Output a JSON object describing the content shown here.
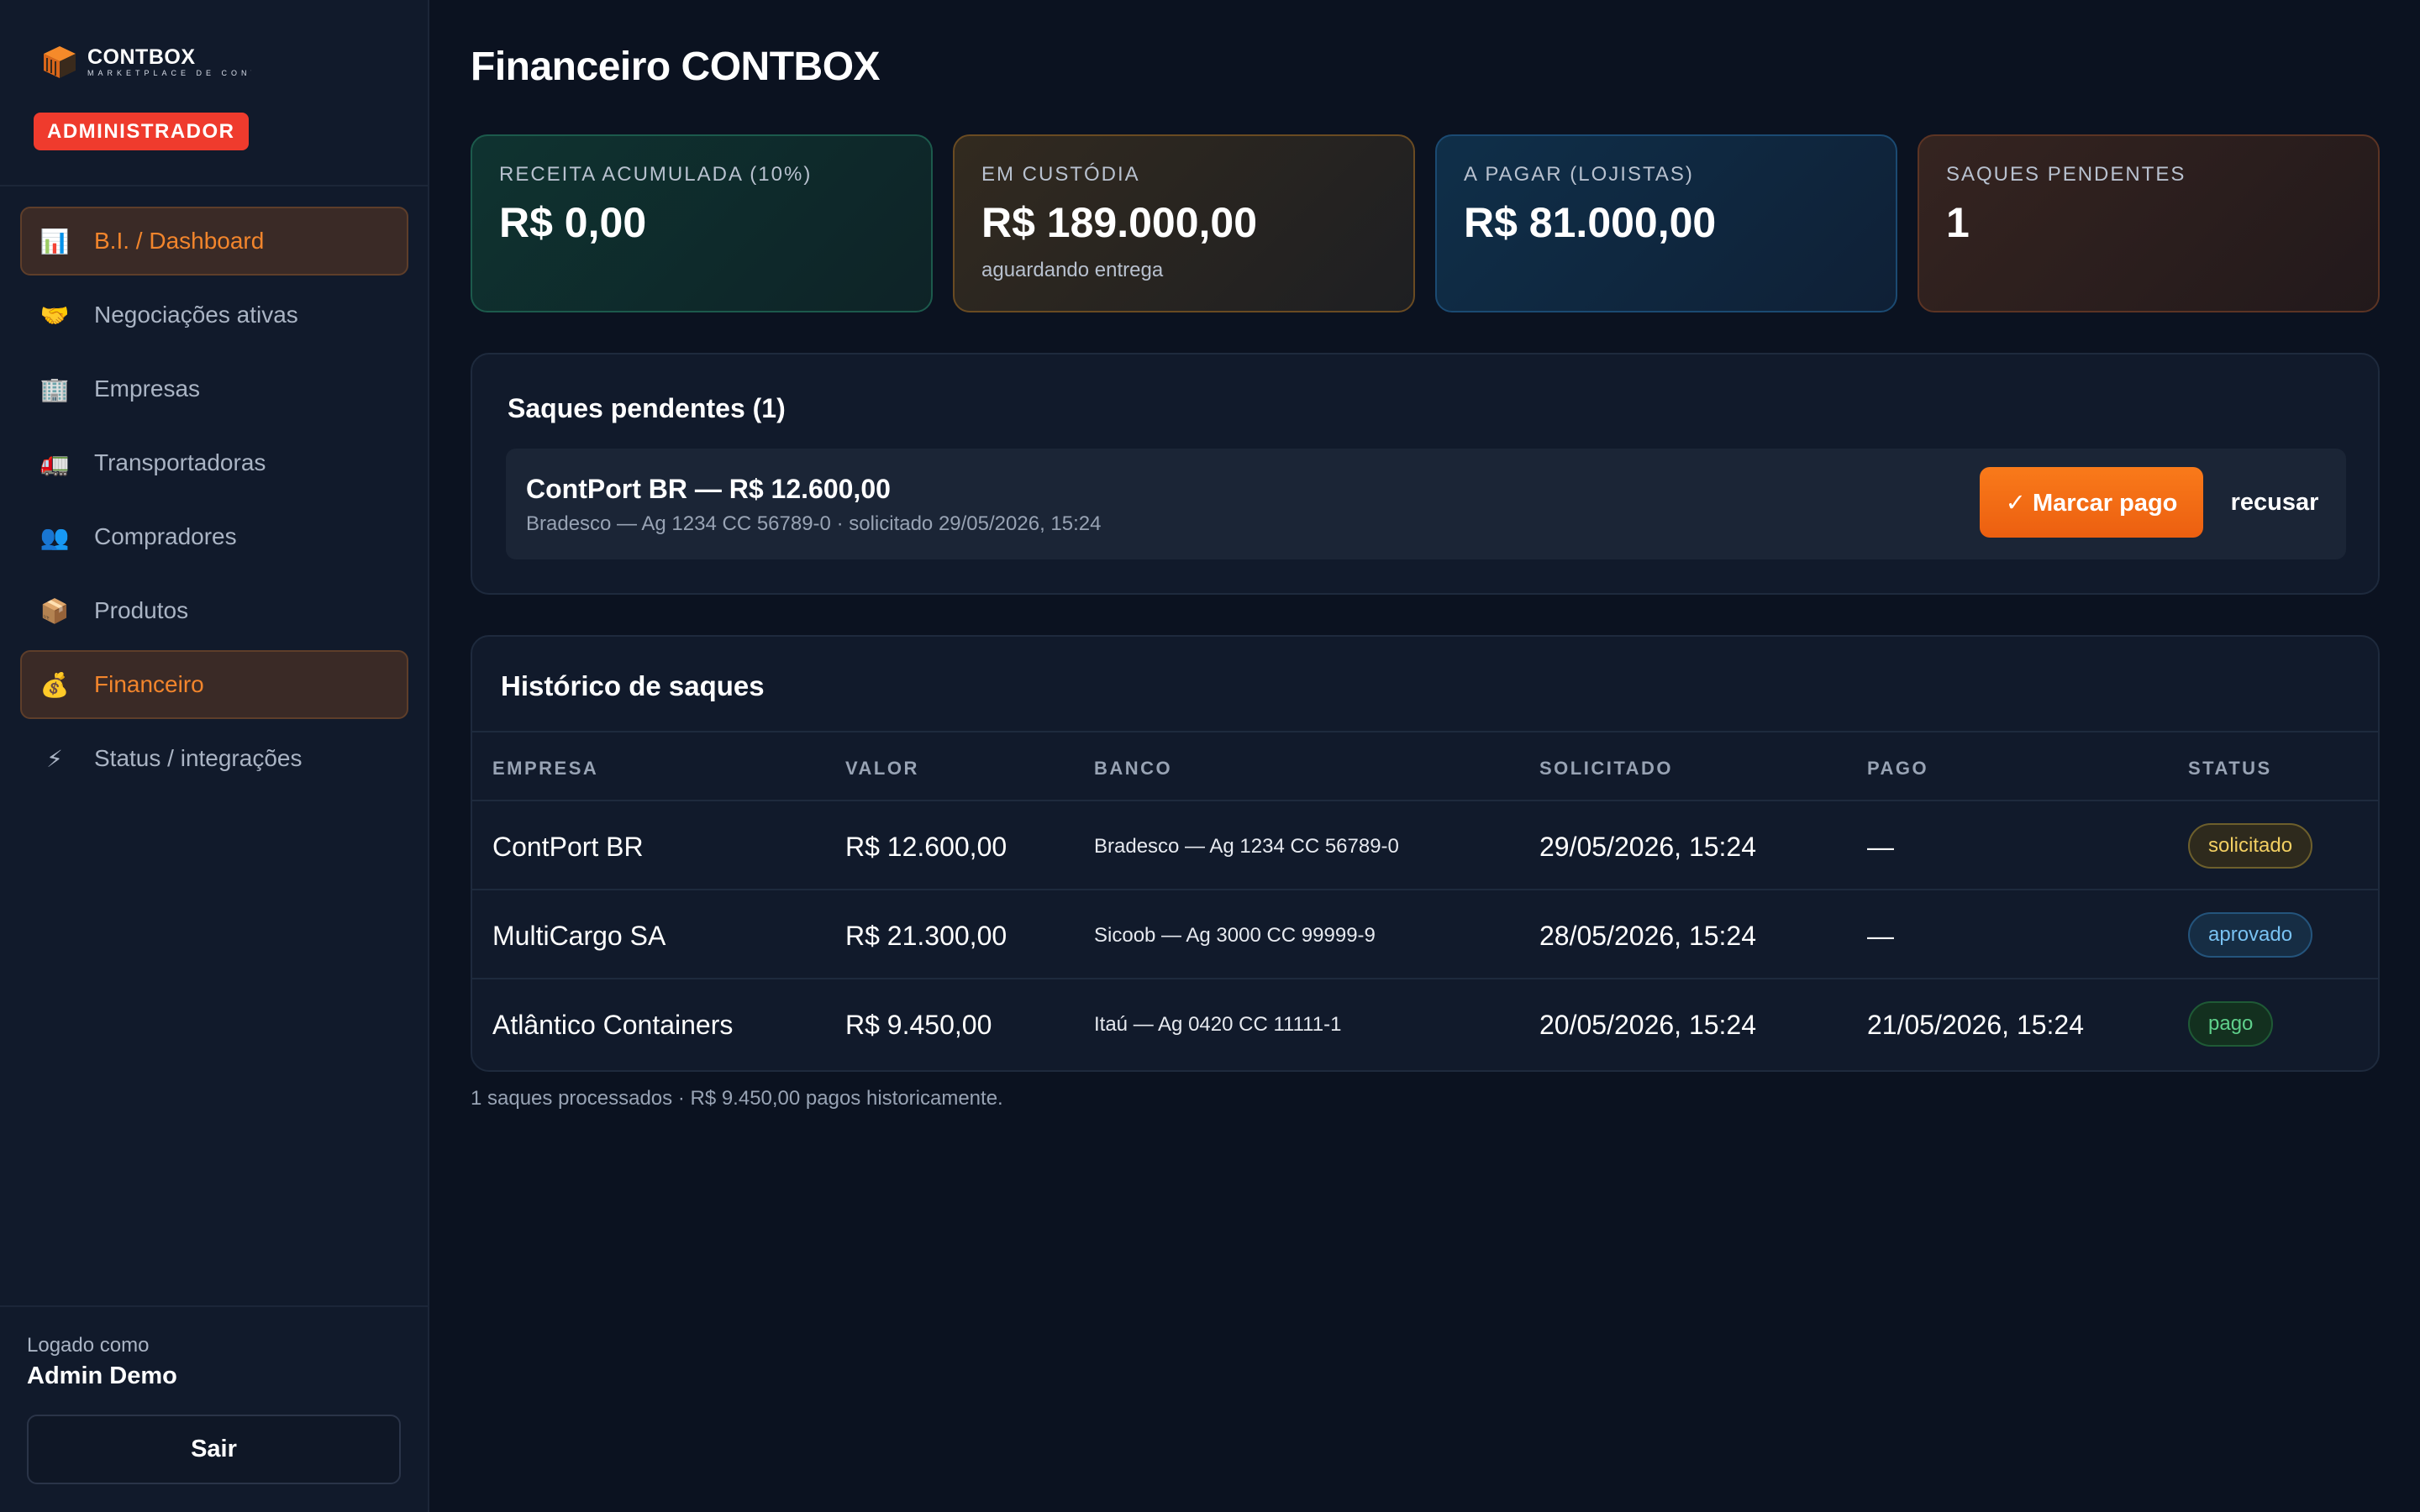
{
  "sidebar": {
    "brand": {
      "name": "CONTBOX",
      "tagline": "MARKETPLACE DE CONTAINERS"
    },
    "role_badge": "ADMINISTRADOR",
    "items": [
      {
        "label": "B.I. / Dashboard",
        "icon": "bar-chart-icon",
        "glyph": "📊",
        "active": true
      },
      {
        "label": "Negociações ativas",
        "icon": "handshake-icon",
        "glyph": "🤝",
        "active": false
      },
      {
        "label": "Empresas",
        "icon": "office-building-icon",
        "glyph": "🏢",
        "active": false
      },
      {
        "label": "Transportadoras",
        "icon": "truck-icon",
        "glyph": "🚛",
        "active": false
      },
      {
        "label": "Compradores",
        "icon": "users-icon",
        "glyph": "👥",
        "active": false
      },
      {
        "label": "Produtos",
        "icon": "package-icon",
        "glyph": "📦",
        "active": false
      },
      {
        "label": "Financeiro",
        "icon": "money-bag-icon",
        "glyph": "💰",
        "active": true
      },
      {
        "label": "Status / integrações",
        "icon": "lightning-icon",
        "glyph": "⚡",
        "active": false
      }
    ],
    "user": {
      "label": "Logado como",
      "name": "Admin Demo"
    },
    "logout_label": "Sair"
  },
  "main": {
    "title": "Financeiro CONTBOX",
    "kpis": [
      {
        "label": "RECEITA ACUMULADA (10%)",
        "value": "R$ 0,00",
        "sub": ""
      },
      {
        "label": "EM CUSTÓDIA",
        "value": "R$ 189.000,00",
        "sub": "aguardando entrega"
      },
      {
        "label": "A PAGAR (LOJISTAS)",
        "value": "R$ 81.000,00",
        "sub": ""
      },
      {
        "label": "SAQUES PENDENTES",
        "value": "1",
        "sub": ""
      }
    ],
    "pending": {
      "title": "Saques pendentes (1)",
      "item": {
        "main": "ContPort BR — R$ 12.600,00",
        "sub": "Bradesco — Ag 1234 CC 56789-0 · solicitado 29/05/2026, 15:24"
      },
      "pay_label": "✓ Marcar pago",
      "refuse_label": "recusar"
    },
    "history": {
      "title": "Histórico de saques",
      "columns": [
        "EMPRESA",
        "VALOR",
        "BANCO",
        "SOLICITADO",
        "PAGO",
        "STATUS"
      ],
      "rows": [
        {
          "empresa": "ContPort BR",
          "valor": "R$ 12.600,00",
          "banco": "Bradesco — Ag 1234 CC 56789-0",
          "solicitado": "29/05/2026, 15:24",
          "pago": "—",
          "status": "solicitado"
        },
        {
          "empresa": "MultiCargo SA",
          "valor": "R$ 21.300,00",
          "banco": "Sicoob — Ag 3000 CC 99999-9",
          "solicitado": "28/05/2026, 15:24",
          "pago": "—",
          "status": "aprovado"
        },
        {
          "empresa": "Atlântico Containers",
          "valor": "R$ 9.450,00",
          "banco": "Itaú — Ag 0420 CC 11111-1",
          "solicitado": "20/05/2026, 15:24",
          "pago": "21/05/2026, 15:24",
          "status": "pago"
        }
      ]
    },
    "footnote": "1 saques processados · R$ 9.450,00 pagos historicamente."
  },
  "colors": {
    "accent": "#f2852c",
    "badge": "#ef3b2d",
    "status_solicitado": "#f2cf62",
    "status_aprovado": "#79c2f2",
    "status_pago": "#5fd08b"
  }
}
